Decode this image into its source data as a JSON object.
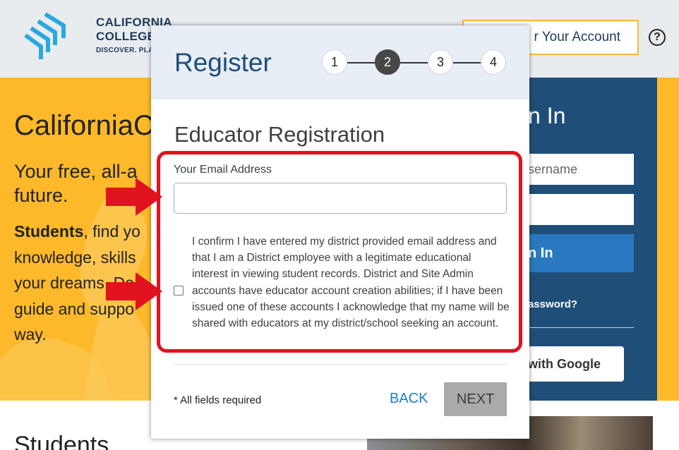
{
  "header": {
    "brand_line1": "CALIFORNIA",
    "brand_line2": "COLLEGES",
    "brand_tagline": "DISCOVER. PLAN.",
    "create_account_label": "r Your Account",
    "help_icon": "?"
  },
  "hero": {
    "title": "CaliforniaC",
    "subtitle": "Your free, all-a future.",
    "body_strong": "Students",
    "body_rest": ", find yo knowledge, skills your dreams. Da guide and suppo way."
  },
  "signin": {
    "title": "n In",
    "username_placeholder": "sername",
    "button_label": "n In",
    "forgot_label": "assword?",
    "google_label": "with Google"
  },
  "section": {
    "title": "Students"
  },
  "modal": {
    "title": "Register",
    "steps": [
      "1",
      "2",
      "3",
      "4"
    ],
    "active_step": 2,
    "form_heading": "Educator Registration",
    "email_label": "Your Email Address",
    "email_value": "",
    "confirm_text": "I confirm I have entered my district provided email address and that I am a District employee with a legitimate educational interest in viewing student records. District and Site Admin accounts have educator account creation abilities; if I have been issued one of these accounts I acknowledge that my name will be shared with educators at my district/school seeking an account.",
    "required_note": "* All fields required",
    "back_label": "BACK",
    "next_label": "NEXT"
  },
  "colors": {
    "accent_yellow": "#fdb929",
    "brand_navy": "#1f4e79",
    "link_blue": "#1a7fcf",
    "annotation_red": "#e0131f"
  }
}
